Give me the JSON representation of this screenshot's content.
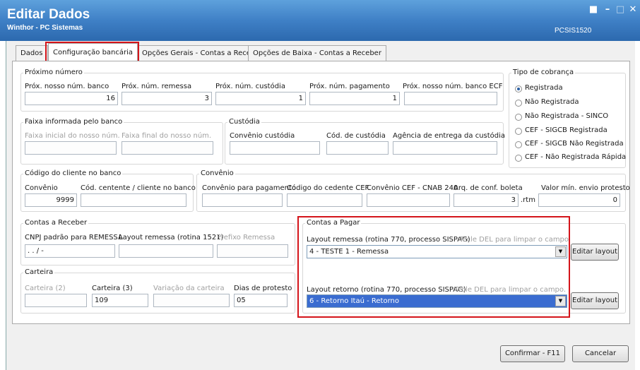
{
  "window": {
    "title": "Editar Dados",
    "subtitle": "Winthor - PC Sistemas",
    "code": "PCSIS1520"
  },
  "tabs": [
    "Dados",
    "Configuração bancária",
    "Opções Gerais - Contas a Receber",
    "Opções de Baixa - Contas a Receber"
  ],
  "proximo": {
    "title": "Próximo número",
    "labels": [
      "Próx. nosso núm. banco",
      "Próx. núm. remessa",
      "Próx. núm. custódia",
      "Próx. núm. pagamento",
      "Próx. nosso núm. banco ECF"
    ],
    "values": [
      "16",
      "3",
      "1",
      "1",
      ""
    ]
  },
  "cobranca": {
    "title": "Tipo de cobrança",
    "options": [
      "Registrada",
      "Não Registrada",
      "Não Registrada - SINCO",
      "CEF - SIGCB Registrada",
      "CEF - SIGCB Não Registrada",
      "CEF - Não Registrada Rápida"
    ],
    "selected": "Registrada"
  },
  "faixa": {
    "title": "Faixa informada pelo banco",
    "labels": [
      "Faixa inicial do nosso núm.",
      "Faixa final do nosso núm."
    ]
  },
  "custodia": {
    "title": "Custódia",
    "labels": [
      "Convênio custódia",
      "Cód. de custódia",
      "Agência de entrega da custódia"
    ]
  },
  "cliente": {
    "title": "Código do cliente no banco",
    "labels": [
      "Convênio",
      "Cód. centente / cliente no banco"
    ],
    "convenio_value": "9999"
  },
  "convenio": {
    "title": "Convênio",
    "labels": [
      "Convênio para pagamento",
      "Código do cedente CEF.",
      "Convênio CEF - CNAB 240",
      "Arq. de conf. boleta",
      "Valor mín. envio protesto"
    ],
    "arq_value": "3",
    "arq_suffix": ".rtm",
    "valor_value": "0"
  },
  "receber": {
    "title": "Contas a Receber",
    "labels": [
      "CNPJ padrão para REMESSA",
      "Layout remessa (rotina 1521)",
      "Prefixo Remessa"
    ],
    "cnpj_value": ". . / -"
  },
  "carteira": {
    "title": "Carteira",
    "labels": [
      "Carteira (2)",
      "Carteira (3)",
      "Variação da carteira",
      "Dias de protesto"
    ],
    "carteira3_value": "109",
    "dias_value": "05"
  },
  "pagar": {
    "title": "Contas a Pagar",
    "remessa_label": "Layout remessa (rotina 770, processo SISPAG)",
    "retorno_label": "Layout retorno (rotina 770, processo SISPAG)",
    "hint": "Tecle DEL para limpar o campo.",
    "remessa_value": "4 - TESTE 1 - Remessa",
    "retorno_value": "6 - Retorno Itaú - Retorno",
    "edit_label": "Editar layout"
  },
  "footer": {
    "confirm": "Confirmar - F11",
    "cancel": "Cancelar"
  }
}
